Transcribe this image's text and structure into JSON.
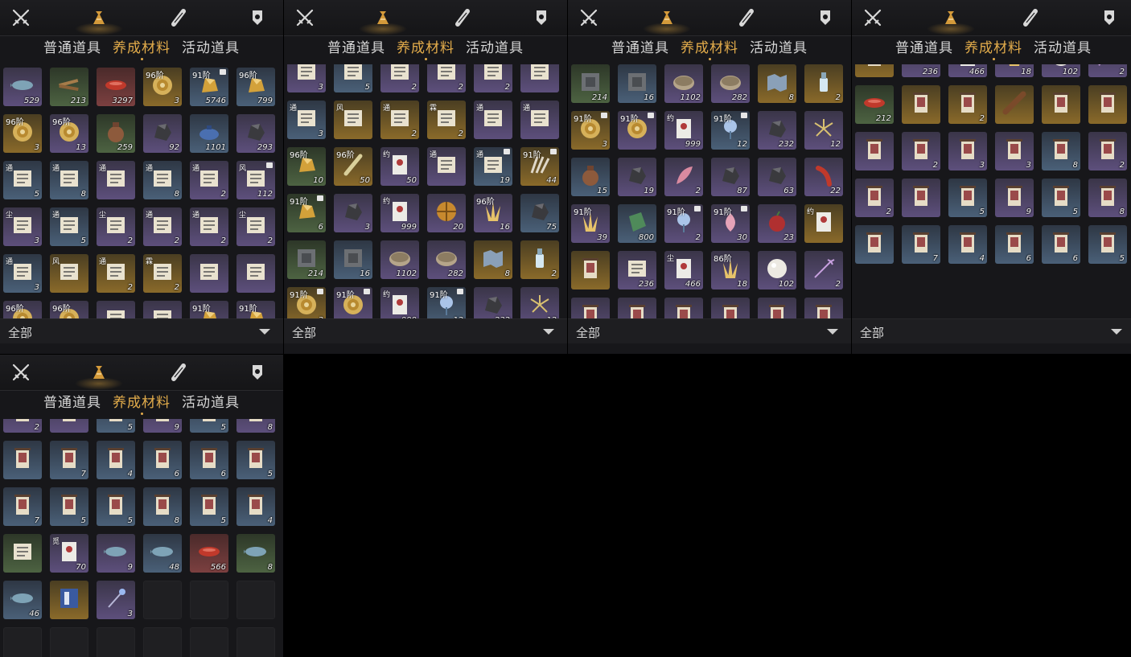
{
  "icons": [
    "swords-icon",
    "bag-icon",
    "scroll-icon",
    "badge-icon"
  ],
  "active_icon": 1,
  "tabs": [
    "普通道具",
    "养成材料",
    "活动道具"
  ],
  "active_tab": 1,
  "filter": {
    "label": "全部"
  },
  "panels": [
    {
      "name": "inventory-panel-1",
      "items": [
        {
          "c": "529",
          "q": "purple",
          "g": "fish"
        },
        {
          "c": "213",
          "q": "green",
          "g": "wood"
        },
        {
          "c": "3297",
          "q": "red",
          "g": "redfish"
        },
        {
          "c": "3",
          "q": "gold",
          "g": "shell",
          "t": "96阶"
        },
        {
          "c": "5746",
          "q": "blue",
          "g": "ore",
          "t": "91阶",
          "l": true
        },
        {
          "c": "799",
          "q": "blue",
          "g": "ore",
          "t": "96阶"
        },
        {
          "c": "3",
          "q": "gold",
          "g": "shell",
          "t": "96阶"
        },
        {
          "c": "13",
          "q": "purple",
          "g": "shell",
          "t": "96阶"
        },
        {
          "c": "259",
          "q": "green",
          "g": "jar"
        },
        {
          "c": "92",
          "q": "purple",
          "g": "rock"
        },
        {
          "c": "1101",
          "q": "blue",
          "g": "teapot"
        },
        {
          "c": "293",
          "q": "purple",
          "g": "rock"
        },
        {
          "c": "5",
          "q": "blue",
          "g": "book",
          "tg": "通"
        },
        {
          "c": "8",
          "q": "blue",
          "g": "book",
          "tg": "通"
        },
        {
          "c": "",
          "q": "purple",
          "g": "book",
          "tg": "通"
        },
        {
          "c": "8",
          "q": "blue",
          "g": "book",
          "tg": "通"
        },
        {
          "c": "2",
          "q": "purple",
          "g": "book",
          "tg": "通"
        },
        {
          "c": "112",
          "q": "purple",
          "g": "book",
          "tg": "风",
          "l": true
        },
        {
          "c": "3",
          "q": "purple",
          "g": "book",
          "tg": "尘"
        },
        {
          "c": "5",
          "q": "blue",
          "g": "book",
          "tg": "通"
        },
        {
          "c": "2",
          "q": "purple",
          "g": "book",
          "tg": "尘"
        },
        {
          "c": "2",
          "q": "purple",
          "g": "book",
          "tg": "通"
        },
        {
          "c": "2",
          "q": "purple",
          "g": "book",
          "tg": "通"
        },
        {
          "c": "2",
          "q": "purple",
          "g": "book",
          "tg": "尘"
        },
        {
          "c": "3",
          "q": "blue",
          "g": "book",
          "tg": "通"
        },
        {
          "c": "",
          "q": "gold",
          "g": "book",
          "tg": "风"
        },
        {
          "c": "2",
          "q": "gold",
          "g": "book",
          "tg": "通"
        },
        {
          "c": "2",
          "q": "gold",
          "g": "book",
          "tg": "霖"
        },
        {
          "c": "",
          "q": "purple",
          "g": "book"
        },
        {
          "c": "",
          "q": "purple",
          "g": "book"
        },
        {
          "c": "",
          "q": "purple",
          "g": "shell",
          "t": "96阶"
        },
        {
          "c": "",
          "q": "purple",
          "g": "shell",
          "t": "96阶"
        },
        {
          "c": "",
          "q": "purple",
          "g": "book"
        },
        {
          "c": "",
          "q": "purple",
          "g": "book"
        },
        {
          "c": "",
          "q": "purple",
          "g": "ore",
          "t": "91阶"
        },
        {
          "c": "",
          "q": "purple",
          "g": "ore",
          "t": "91阶"
        }
      ]
    },
    {
      "name": "inventory-panel-2",
      "items": [
        {
          "c": "3",
          "q": "purple",
          "g": "book"
        },
        {
          "c": "5",
          "q": "blue",
          "g": "book"
        },
        {
          "c": "2",
          "q": "purple",
          "g": "book"
        },
        {
          "c": "2",
          "q": "purple",
          "g": "book"
        },
        {
          "c": "2",
          "q": "purple",
          "g": "book"
        },
        {
          "c": "",
          "q": "purple",
          "g": "book"
        },
        {
          "c": "3",
          "q": "blue",
          "g": "book",
          "tg": "通"
        },
        {
          "c": "",
          "q": "gold",
          "g": "book",
          "tg": "风"
        },
        {
          "c": "2",
          "q": "gold",
          "g": "book",
          "tg": "通"
        },
        {
          "c": "2",
          "q": "gold",
          "g": "book",
          "tg": "霖"
        },
        {
          "c": "",
          "q": "purple",
          "g": "book",
          "tg": "通"
        },
        {
          "c": "",
          "q": "purple",
          "g": "book",
          "tg": "通"
        },
        {
          "c": "10",
          "q": "green",
          "g": "ore",
          "t": "96阶"
        },
        {
          "c": "50",
          "q": "gold",
          "g": "feather",
          "t": "96阶"
        },
        {
          "c": "50",
          "q": "purple",
          "g": "paper",
          "tg": "约"
        },
        {
          "c": "",
          "q": "purple",
          "g": "book",
          "tg": "通"
        },
        {
          "c": "19",
          "q": "blue",
          "g": "book",
          "tg": "通",
          "l": true
        },
        {
          "c": "44",
          "q": "gold",
          "g": "claw",
          "t": "91阶",
          "l": true
        },
        {
          "c": "6",
          "q": "green",
          "g": "ore",
          "t": "91阶",
          "l": true
        },
        {
          "c": "3",
          "q": "purple",
          "g": "rock"
        },
        {
          "c": "999",
          "q": "purple",
          "g": "paper",
          "tg": "约"
        },
        {
          "c": "20",
          "q": "purple",
          "g": "orb"
        },
        {
          "c": "16",
          "q": "purple",
          "g": "crystal",
          "t": "96阶"
        },
        {
          "c": "75",
          "q": "blue",
          "g": "rock"
        },
        {
          "c": "214",
          "q": "green",
          "g": "stone"
        },
        {
          "c": "16",
          "q": "blue",
          "g": "stone"
        },
        {
          "c": "1102",
          "q": "purple",
          "g": "disc"
        },
        {
          "c": "282",
          "q": "purple",
          "g": "disc"
        },
        {
          "c": "8",
          "q": "gold",
          "g": "map"
        },
        {
          "c": "2",
          "q": "gold",
          "g": "bottle"
        },
        {
          "c": "3",
          "q": "gold",
          "g": "shell",
          "t": "91阶",
          "l": true
        },
        {
          "c": "",
          "q": "purple",
          "g": "shell",
          "t": "91阶",
          "l": true
        },
        {
          "c": "999",
          "q": "purple",
          "g": "paper",
          "tg": "约"
        },
        {
          "c": "12",
          "q": "blue",
          "g": "flower",
          "t": "91阶",
          "l": true
        },
        {
          "c": "232",
          "q": "purple",
          "g": "rock"
        },
        {
          "c": "12",
          "q": "purple",
          "g": "grain"
        }
      ]
    },
    {
      "name": "inventory-panel-3",
      "items": [
        {
          "c": "214",
          "q": "green",
          "g": "stone"
        },
        {
          "c": "16",
          "q": "blue",
          "g": "stone"
        },
        {
          "c": "1102",
          "q": "purple",
          "g": "disc"
        },
        {
          "c": "282",
          "q": "purple",
          "g": "disc"
        },
        {
          "c": "8",
          "q": "gold",
          "g": "map"
        },
        {
          "c": "2",
          "q": "gold",
          "g": "bottle"
        },
        {
          "c": "3",
          "q": "gold",
          "g": "shell",
          "t": "91阶",
          "l": true
        },
        {
          "c": "",
          "q": "purple",
          "g": "shell",
          "t": "91阶",
          "l": true
        },
        {
          "c": "999",
          "q": "purple",
          "g": "paper",
          "tg": "约"
        },
        {
          "c": "12",
          "q": "blue",
          "g": "flower",
          "t": "91阶",
          "l": true
        },
        {
          "c": "232",
          "q": "purple",
          "g": "rock"
        },
        {
          "c": "12",
          "q": "purple",
          "g": "grain"
        },
        {
          "c": "15",
          "q": "blue",
          "g": "jar"
        },
        {
          "c": "19",
          "q": "purple",
          "g": "rock"
        },
        {
          "c": "2",
          "q": "purple",
          "g": "petal"
        },
        {
          "c": "87",
          "q": "purple",
          "g": "rock"
        },
        {
          "c": "63",
          "q": "purple",
          "g": "rock"
        },
        {
          "c": "22",
          "q": "purple",
          "g": "pepper"
        },
        {
          "c": "39",
          "q": "purple",
          "g": "crystal",
          "t": "91阶"
        },
        {
          "c": "800",
          "q": "blue",
          "g": "jade"
        },
        {
          "c": "2",
          "q": "purple",
          "g": "flower",
          "t": "91阶",
          "l": true
        },
        {
          "c": "30",
          "q": "purple",
          "g": "bud",
          "t": "91阶",
          "l": true
        },
        {
          "c": "23",
          "q": "purple",
          "g": "berry"
        },
        {
          "c": "",
          "q": "gold",
          "g": "paper",
          "tg": "约"
        },
        {
          "c": "",
          "q": "gold",
          "g": "scroll"
        },
        {
          "c": "236",
          "q": "purple",
          "g": "book"
        },
        {
          "c": "466",
          "q": "purple",
          "g": "paper",
          "tg": "尘"
        },
        {
          "c": "18",
          "q": "purple",
          "g": "crystal",
          "t": "86阶"
        },
        {
          "c": "102",
          "q": "purple",
          "g": "pearl"
        },
        {
          "c": "2",
          "q": "purple",
          "g": "firework"
        },
        {
          "c": "",
          "q": "purple",
          "g": "scroll"
        },
        {
          "c": "",
          "q": "purple",
          "g": "scroll"
        },
        {
          "c": "",
          "q": "purple",
          "g": "scroll"
        },
        {
          "c": "",
          "q": "purple",
          "g": "scroll"
        },
        {
          "c": "",
          "q": "purple",
          "g": "scroll"
        },
        {
          "c": "",
          "q": "purple",
          "g": "scroll"
        }
      ]
    },
    {
      "name": "inventory-panel-4",
      "items": [
        {
          "c": "",
          "q": "gold",
          "g": "scroll"
        },
        {
          "c": "236",
          "q": "purple",
          "g": "book"
        },
        {
          "c": "466",
          "q": "purple",
          "g": "paper",
          "tg": "尘"
        },
        {
          "c": "18",
          "q": "purple",
          "g": "crystal",
          "t": "86阶"
        },
        {
          "c": "102",
          "q": "purple",
          "g": "pearl"
        },
        {
          "c": "2",
          "q": "purple",
          "g": "firework"
        },
        {
          "c": "212",
          "q": "green",
          "g": "redfish"
        },
        {
          "c": "",
          "q": "gold",
          "g": "scroll"
        },
        {
          "c": "2",
          "q": "gold",
          "g": "scroll"
        },
        {
          "c": "",
          "q": "gold",
          "g": "stick"
        },
        {
          "c": "",
          "q": "gold",
          "g": "scroll"
        },
        {
          "c": "",
          "q": "gold",
          "g": "scroll"
        },
        {
          "c": "",
          "q": "purple",
          "g": "scroll"
        },
        {
          "c": "2",
          "q": "purple",
          "g": "scroll"
        },
        {
          "c": "3",
          "q": "purple",
          "g": "scroll"
        },
        {
          "c": "3",
          "q": "purple",
          "g": "scroll"
        },
        {
          "c": "8",
          "q": "blue",
          "g": "scroll"
        },
        {
          "c": "2",
          "q": "purple",
          "g": "scroll"
        },
        {
          "c": "2",
          "q": "purple",
          "g": "scroll"
        },
        {
          "c": "",
          "q": "purple",
          "g": "scroll"
        },
        {
          "c": "5",
          "q": "blue",
          "g": "scroll"
        },
        {
          "c": "9",
          "q": "purple",
          "g": "scroll"
        },
        {
          "c": "5",
          "q": "blue",
          "g": "scroll"
        },
        {
          "c": "8",
          "q": "purple",
          "g": "scroll"
        },
        {
          "c": "",
          "q": "blue",
          "g": "scroll"
        },
        {
          "c": "7",
          "q": "blue",
          "g": "scroll"
        },
        {
          "c": "4",
          "q": "blue",
          "g": "scroll"
        },
        {
          "c": "6",
          "q": "blue",
          "g": "scroll"
        },
        {
          "c": "6",
          "q": "blue",
          "g": "scroll"
        },
        {
          "c": "5",
          "q": "blue",
          "g": "scroll"
        }
      ]
    },
    {
      "name": "inventory-panel-5",
      "items": [
        {
          "c": "2",
          "q": "purple",
          "g": "scroll"
        },
        {
          "c": "",
          "q": "purple",
          "g": "scroll"
        },
        {
          "c": "5",
          "q": "blue",
          "g": "scroll"
        },
        {
          "c": "9",
          "q": "purple",
          "g": "scroll"
        },
        {
          "c": "5",
          "q": "blue",
          "g": "scroll"
        },
        {
          "c": "8",
          "q": "purple",
          "g": "scroll"
        },
        {
          "c": "",
          "q": "blue",
          "g": "scroll"
        },
        {
          "c": "7",
          "q": "blue",
          "g": "scroll"
        },
        {
          "c": "4",
          "q": "blue",
          "g": "scroll"
        },
        {
          "c": "6",
          "q": "blue",
          "g": "scroll"
        },
        {
          "c": "6",
          "q": "blue",
          "g": "scroll"
        },
        {
          "c": "5",
          "q": "blue",
          "g": "scroll"
        },
        {
          "c": "7",
          "q": "blue",
          "g": "scroll"
        },
        {
          "c": "5",
          "q": "blue",
          "g": "scroll"
        },
        {
          "c": "5",
          "q": "blue",
          "g": "scroll"
        },
        {
          "c": "8",
          "q": "blue",
          "g": "scroll"
        },
        {
          "c": "5",
          "q": "blue",
          "g": "scroll"
        },
        {
          "c": "4",
          "q": "blue",
          "g": "scroll"
        },
        {
          "c": "",
          "q": "green",
          "g": "book"
        },
        {
          "c": "70",
          "q": "purple",
          "g": "paper",
          "tg": "觅"
        },
        {
          "c": "9",
          "q": "purple",
          "g": "fish"
        },
        {
          "c": "48",
          "q": "blue",
          "g": "fish"
        },
        {
          "c": "566",
          "q": "red",
          "g": "redfish"
        },
        {
          "c": "8",
          "q": "green",
          "g": "fish"
        },
        {
          "c": "46",
          "q": "blue",
          "g": "fish"
        },
        {
          "c": "",
          "q": "gold",
          "g": "bluebook"
        },
        {
          "c": "3",
          "q": "purple",
          "g": "wand"
        },
        {
          "c": "",
          "q": "empty",
          "g": ""
        },
        {
          "c": "",
          "q": "empty",
          "g": ""
        },
        {
          "c": "",
          "q": "empty",
          "g": ""
        },
        {
          "c": "",
          "q": "empty",
          "g": ""
        },
        {
          "c": "",
          "q": "empty",
          "g": ""
        },
        {
          "c": "",
          "q": "empty",
          "g": ""
        },
        {
          "c": "",
          "q": "empty",
          "g": ""
        },
        {
          "c": "",
          "q": "empty",
          "g": ""
        },
        {
          "c": "",
          "q": "empty",
          "g": ""
        }
      ]
    }
  ]
}
